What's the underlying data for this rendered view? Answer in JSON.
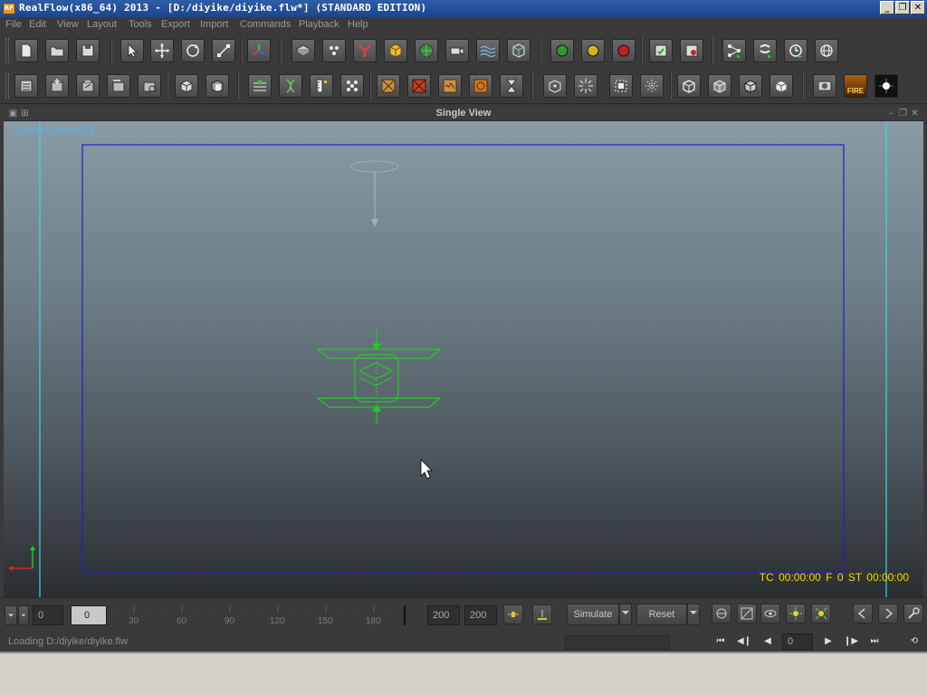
{
  "window": {
    "title": "RealFlow(x86_64) 2013 - [D:/diyike/diyike.flw*] (STANDARD EDITION)",
    "icon_label": "RF",
    "minimize": "_",
    "maximize": "❐",
    "close": "✕"
  },
  "menu": [
    "File",
    "Edit",
    "View",
    "Layout",
    "Tools",
    "Export",
    "Import",
    "Commands",
    "Playback",
    "Help"
  ],
  "toolbar1": [
    {
      "name": "new-file-button",
      "icon": "new-file-icon"
    },
    {
      "name": "open-file-button",
      "icon": "folder-icon"
    },
    {
      "name": "save-file-button",
      "icon": "save-icon"
    },
    {
      "name": "select-tool-button",
      "icon": "arrow-cursor-icon"
    },
    {
      "name": "move-tool-button",
      "icon": "move-icon"
    },
    {
      "name": "rotate-tool-button",
      "icon": "rotate-icon"
    },
    {
      "name": "scale-tool-button",
      "icon": "scale-icon"
    },
    {
      "name": "axis-tool-button",
      "icon": "axis-icon"
    },
    {
      "name": "add-object-button",
      "icon": "box-icon"
    },
    {
      "name": "add-particles-button",
      "icon": "particles-icon"
    },
    {
      "name": "add-daemon-button",
      "icon": "daemon-icon"
    },
    {
      "name": "add-rigid-button",
      "icon": "cube-icon"
    },
    {
      "name": "add-mesh-button",
      "icon": "mesh-icon"
    },
    {
      "name": "add-camera-button",
      "icon": "camera-icon"
    },
    {
      "name": "add-wave-button",
      "icon": "wave-icon"
    },
    {
      "name": "add-grid-button",
      "icon": "grid-cube-icon"
    },
    {
      "name": "sim-green-button",
      "icon": "green-circle-icon"
    },
    {
      "name": "sim-yellow-button",
      "icon": "yellow-circle-icon"
    },
    {
      "name": "sim-red-button",
      "icon": "red-circle-icon"
    },
    {
      "name": "export-save-button",
      "icon": "save-green-icon"
    },
    {
      "name": "export-red-button",
      "icon": "save-red-icon"
    },
    {
      "name": "batch-button",
      "icon": "nodes-icon"
    },
    {
      "name": "script-button",
      "icon": "script-icon"
    },
    {
      "name": "clock-button",
      "icon": "clock-icon"
    },
    {
      "name": "globe-button",
      "icon": "globe-icon"
    }
  ],
  "toolbar2": [
    {
      "name": "tool-a-button",
      "icon": "list-icon"
    },
    {
      "name": "tool-b-button",
      "icon": "plus-box-icon"
    },
    {
      "name": "tool-c-button",
      "icon": "minus-box-icon"
    },
    {
      "name": "tool-d-button",
      "icon": "link-box-icon"
    },
    {
      "name": "tool-e-button",
      "icon": "unlink-box-icon"
    },
    {
      "name": "tool-f-button",
      "icon": "cube-front-icon"
    },
    {
      "name": "tool-g-button",
      "icon": "cube-back-icon"
    },
    {
      "name": "tool-h-button",
      "icon": "layers-icon"
    },
    {
      "name": "tool-i-button",
      "icon": "dna-icon"
    },
    {
      "name": "tool-j-button",
      "icon": "ruler-icon"
    },
    {
      "name": "tool-k-button",
      "icon": "dots-icon"
    },
    {
      "name": "tool-l-button",
      "icon": "crate-icon"
    },
    {
      "name": "tool-m-button",
      "icon": "crate-red-icon"
    },
    {
      "name": "tool-n-button",
      "icon": "crate-crack-icon"
    },
    {
      "name": "tool-o-button",
      "icon": "crate-orange-icon"
    },
    {
      "name": "tool-p-button",
      "icon": "hourglass-icon"
    },
    {
      "name": "tool-q-button",
      "icon": "cube-dots-icon"
    },
    {
      "name": "tool-r-button",
      "icon": "burst-icon"
    },
    {
      "name": "tool-s-button",
      "icon": "frame-icon"
    },
    {
      "name": "tool-t-button",
      "icon": "spark-icon"
    },
    {
      "name": "tool-u-button",
      "icon": "cube-outline-icon"
    },
    {
      "name": "tool-v-button",
      "icon": "cube-half-icon"
    },
    {
      "name": "tool-w-button",
      "icon": "cube-solid-icon"
    },
    {
      "name": "tool-x-button",
      "icon": "cube-light-icon"
    },
    {
      "name": "tool-y-button",
      "icon": "render-icon"
    },
    {
      "name": "fire-button",
      "icon": "fire-icon",
      "label": "FIRE"
    },
    {
      "name": "tool-z-button",
      "icon": "flare-icon"
    }
  ],
  "viewport": {
    "title": "Single View",
    "camera": "SceneCamera01",
    "timecode": "TC 00:00:00   F 0    ST 00:00:00"
  },
  "timeline": {
    "start": "0",
    "current": "0",
    "ticks": [
      "30",
      "60",
      "90",
      "120",
      "150",
      "180"
    ],
    "end1": "200",
    "end2": "200",
    "simulate": "Simulate",
    "reset": "Reset",
    "frame": "0"
  },
  "status": {
    "text": "Loading D:/diyike/diyike.flw"
  },
  "colors": {
    "accent_green": "#22cc22",
    "frame_blue": "#2020c8",
    "safe_cyan": "#3fd6e0",
    "timecode_yellow": "#ffd400"
  }
}
